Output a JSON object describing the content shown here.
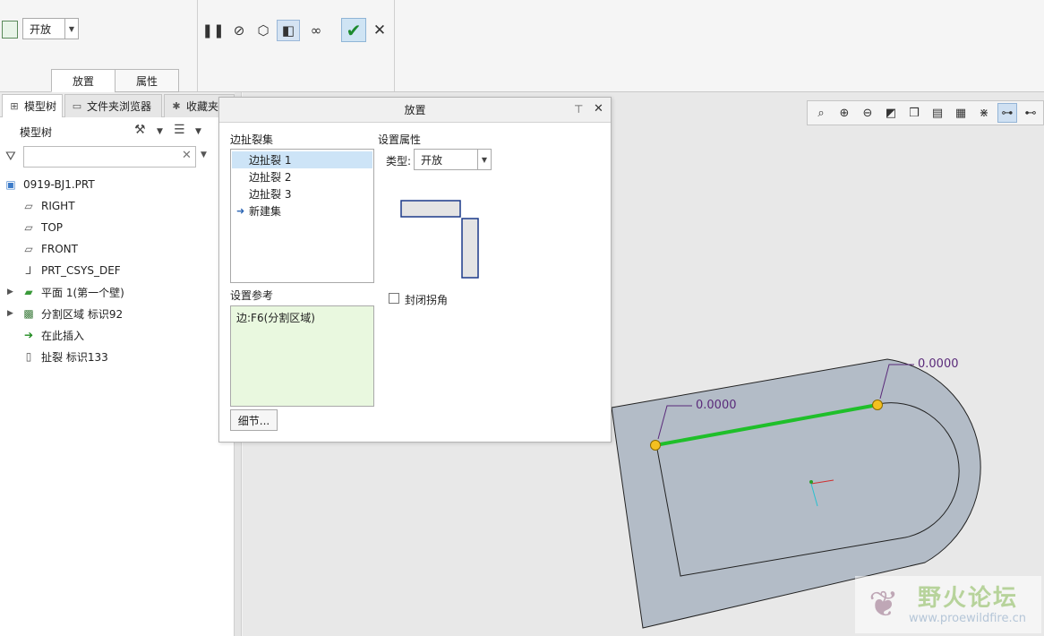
{
  "ribbon": {
    "type_value": "开放",
    "tabs": [
      "放置",
      "属性"
    ]
  },
  "left_panel": {
    "tabs": [
      "模型树",
      "文件夹浏览器",
      "收藏夹"
    ],
    "tree_title": "模型树",
    "tree": [
      {
        "label": "0919-BJ1.PRT",
        "icon": "part-icon"
      },
      {
        "label": "RIGHT",
        "icon": "datum-plane-icon"
      },
      {
        "label": "TOP",
        "icon": "datum-plane-icon"
      },
      {
        "label": "FRONT",
        "icon": "datum-plane-icon"
      },
      {
        "label": "PRT_CSYS_DEF",
        "icon": "csys-icon"
      },
      {
        "label": "平面 1(第一个壁)",
        "icon": "wall-icon"
      },
      {
        "label": "分割区域 标识92",
        "icon": "split-region-icon"
      },
      {
        "label": "在此插入",
        "icon": "insert-arrow-icon"
      },
      {
        "label": "扯裂 标识133",
        "icon": "rip-icon"
      }
    ]
  },
  "dialog": {
    "title": "放置",
    "rip_sets_label": "边扯裂集",
    "rip_sets": [
      "边扯裂 1",
      "边扯裂 2",
      "边扯裂 3"
    ],
    "new_set": "新建集",
    "properties_label": "设置属性",
    "type_label": "类型:",
    "type_value": "开放",
    "close_corner_label": "封闭拐角",
    "references_label": "设置参考",
    "reference_value": "边:F6(分割区域)",
    "details_button": "细节..."
  },
  "graphics": {
    "dim_left": "0.0000",
    "dim_right": "0.0000"
  },
  "watermark": {
    "name": "野火论坛",
    "url": "www.proewildfire.cn"
  },
  "colors": {
    "selected_edge": "#1fbf2a",
    "part_fill": "#b3bcc7",
    "dimension_text": "#5a2a7a"
  }
}
